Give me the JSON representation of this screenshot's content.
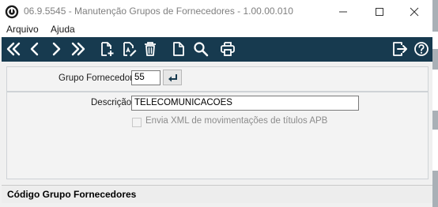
{
  "window": {
    "title": "06.9.5545 - Manutenção Grupos de Fornecedores - 1.00.00.010",
    "controls": {
      "minimize": "minimize-icon",
      "maximize": "maximize-icon",
      "close": "close-icon"
    }
  },
  "menu": {
    "items": [
      {
        "label": "Arquivo"
      },
      {
        "label": "Ajuda"
      }
    ]
  },
  "toolbar": {
    "background": "#173a4f",
    "left_buttons": [
      "first-record-icon",
      "previous-record-icon",
      "next-record-icon",
      "last-record-icon",
      "new-record-icon",
      "edit-record-icon",
      "delete-icon",
      "blank-document-icon",
      "search-icon",
      "print-icon"
    ],
    "right_buttons": [
      "exit-icon",
      "help-icon"
    ]
  },
  "form": {
    "grupo_label": "Grupo Fornecedor:",
    "grupo_value": "55",
    "descricao_label": "Descrição:",
    "descricao_value": "TELECOMUNICACOES",
    "checkbox_label": "Envia XML de movimentações de títulos APB",
    "checkbox_checked": false
  },
  "status": {
    "text": "Código Grupo Fornecedores"
  }
}
